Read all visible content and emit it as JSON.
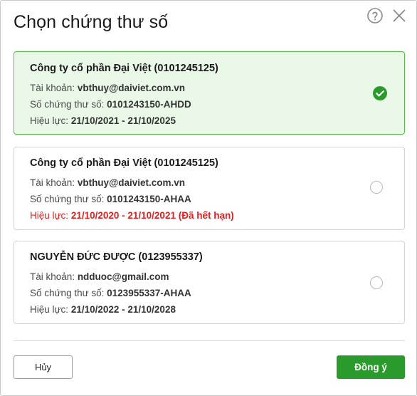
{
  "dialog": {
    "title": "Chọn chứng thư số",
    "help_icon": "question-circle-icon",
    "close_icon": "close-x-icon"
  },
  "labels": {
    "account": "Tài khoản:",
    "cert_no": "Số chứng thư số:",
    "validity": "Hiệu lực:"
  },
  "certificates": [
    {
      "name": "Công ty cổ phần Đại Việt (0101245125)",
      "account": "vbthuy@daiviet.com.vn",
      "cert_no": "0101243150-AHDD",
      "validity": "21/10/2021 - 21/10/2025",
      "selected": true,
      "expired": false
    },
    {
      "name": "Công ty cổ phần Đại Việt (0101245125)",
      "account": "vbthuy@daiviet.com.vn",
      "cert_no": "0101243150-AHAA",
      "validity": "21/10/2020 - 21/10/2021 (Đã hết hạn)",
      "selected": false,
      "expired": true
    },
    {
      "name": "NGUYỄN ĐỨC ĐƯỢC (0123955337)",
      "account": "ndduoc@gmail.com",
      "cert_no": "0123955337-AHAA",
      "validity": "21/10/2022 - 21/10/2028",
      "selected": false,
      "expired": false
    }
  ],
  "footer": {
    "cancel_label": "Hủy",
    "ok_label": "Đồng ý"
  },
  "colors": {
    "accent_green": "#2a9a2c",
    "selected_bg": "#eaf8e8",
    "selected_border": "#57b947",
    "expired_red": "#e02020"
  }
}
